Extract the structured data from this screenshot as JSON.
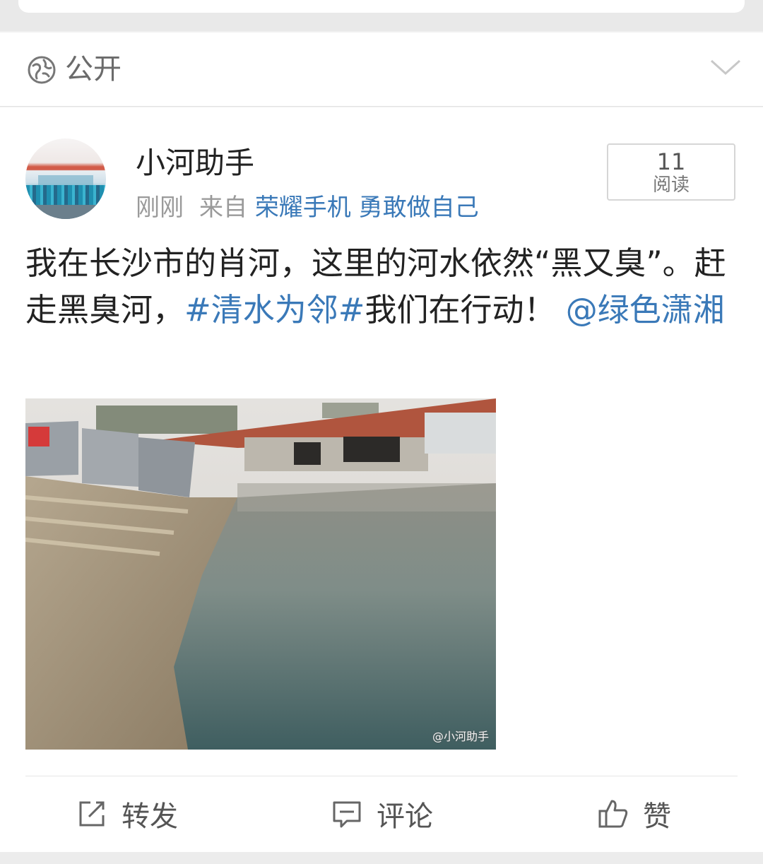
{
  "privacy": {
    "label": "公开",
    "icon": "globe-icon",
    "expand_icon": "chevron-down-icon"
  },
  "post": {
    "user": {
      "name": "小河助手",
      "avatar": "avatar"
    },
    "meta": {
      "time": "刚刚",
      "from_label": "来自",
      "source": "荣耀手机 勇敢做自己"
    },
    "read_count": "11",
    "read_label": "阅读",
    "text": {
      "part1": "我在长沙市的肖河，这里的河水依然“黑又臭”。赶走黑臭河，",
      "topic": "#清水为邻#",
      "part2": "我们在行动！",
      "mention": "@绿色潇湘"
    },
    "image": {
      "watermark": "@小河助手"
    }
  },
  "actions": {
    "repost_label": "转发",
    "comment_label": "评论",
    "like_label": "赞"
  },
  "colors": {
    "link": "#3a79b8",
    "text": "#222222",
    "meta": "#9a9a9a"
  }
}
